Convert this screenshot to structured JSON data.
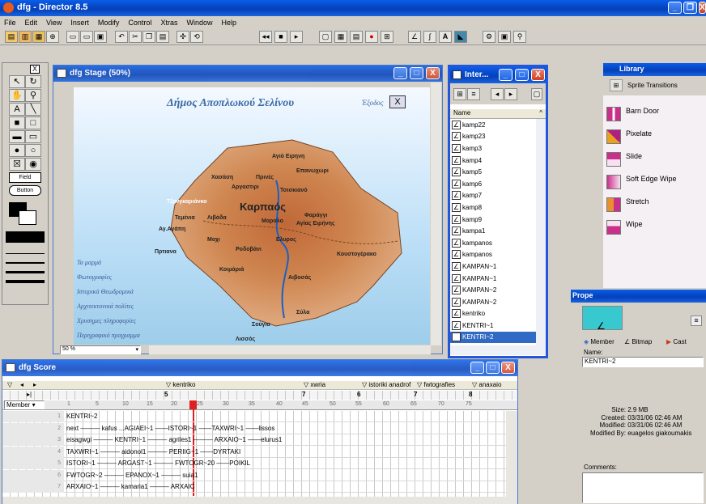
{
  "app": {
    "title": "dfg - Director 8.5"
  },
  "menu": [
    "File",
    "Edit",
    "View",
    "Insert",
    "Modify",
    "Control",
    "Xtras",
    "Window",
    "Help"
  ],
  "stage": {
    "title": "dfg Stage (50%)",
    "zoom": "50 %",
    "map_title": "Δήμος Αποπλωκού Σελίνου",
    "exit_label": "Έξοδος",
    "side_menu": [
      "Τα μαρμά",
      "Φωτογραφίες",
      "Ιστορικά Θεωδρομικά",
      "Αρχιτεκτονικά πολίτες",
      "Χρυσημες πληροφορίες",
      "Περιγραφικό προγραμμα"
    ],
    "places": [
      "Αγιό Ειρηνη",
      "Επανωχωρι",
      "Χασάση",
      "Πρινές",
      "Αργαστιρι",
      "Τσισκιανό",
      "Τζανγκαριάνκο",
      "Καρπαός",
      "Τεμένια",
      "Λιβάδα",
      "Μαραλο",
      "Φαράγγι",
      "Αγίας Ειρήνης",
      "Αγ.Αγάπη",
      "Ροδοβάνι",
      "Ελυρος",
      "Μοχι",
      "Κουστογέρακο",
      "Πρτιανα",
      "Κοιμάριά",
      "Αιβοσάς",
      "Σούγια",
      "Σύλα",
      "Λισσός"
    ]
  },
  "inter": {
    "title": "Inter...",
    "col_name": "Name",
    "items": [
      "kamp22",
      "kamp23",
      "kamp3",
      "kamp4",
      "kamp5",
      "kamp6",
      "kamp7",
      "kamp8",
      "kamp9",
      "kampa1",
      "kampanos",
      "kampanos",
      "KAMPAN~1",
      "KAMPAN~1",
      "KAMPAN~2",
      "KAMPAN~2",
      "kentriko",
      "KENTRI~1",
      "KENTRI~2"
    ],
    "selected_index": 18
  },
  "library": {
    "title": "Library",
    "category": "Sprite Transitions",
    "items": [
      "Barn Door",
      "Pixelate",
      "Slide",
      "Soft Edge Wipe",
      "Stretch",
      "Wipe"
    ]
  },
  "property": {
    "title": "Prope",
    "tabs": [
      "Member",
      "Bitmap",
      "Cast"
    ],
    "name_label": "Name:",
    "name_value": "KENTRI~2",
    "fields": [
      {
        "label": "Size:",
        "value": "2.9 MB"
      },
      {
        "label": "Created:",
        "value": "03/31/06 02:46 AM"
      },
      {
        "label": "Modified:",
        "value": "03/31/06 02:46 AM"
      },
      {
        "label": "Modified By:",
        "value": "euagelos giakoumakis"
      }
    ],
    "comments_label": "Comments:"
  },
  "score": {
    "title": "dfg Score",
    "mode": "Member",
    "markers": [
      "kentriko",
      "xwria",
      "istoriki anadrof",
      "fwtografies",
      "anaxaio"
    ],
    "marker_numbers": [
      "5",
      "7",
      "6",
      "7",
      "8"
    ],
    "frame_numbers": [
      "1",
      "5",
      "10",
      "15",
      "20",
      "25",
      "30",
      "35",
      "40",
      "45",
      "50",
      "55",
      "60",
      "65",
      "70",
      "75"
    ],
    "rows": [
      "KENTRI~2",
      "next ——— kafus    ...AGIAEI~1 ——ISTORI~1 ——TAXWRI~1 ——lissos",
      "eisagwgi ——— KENTRI~1 ——— agriles1 ——— ARXAIO~1 ——elurus1",
      "TAXWRI~1 ——— aidonol1 ——— PERIIG~1 ——DYRTAKI",
      "ISTORI~1 ——— ARGAST~1 ——— FWTOGR~20 ——POIKIL",
      "FWTOGR~2 ——— EPANOX~1 ——— suia1",
      "ARXAIO~1 ——— kamaria1 ——— ARXAIC"
    ]
  }
}
